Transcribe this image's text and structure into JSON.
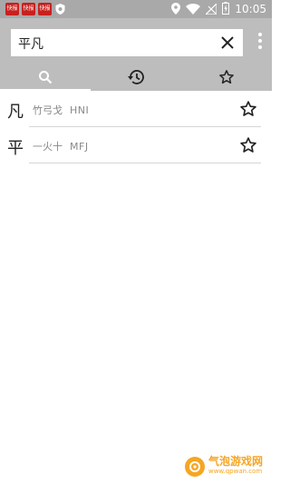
{
  "status_bar": {
    "app_icons": [
      "快报",
      "快报",
      "快报"
    ],
    "time": "10:05"
  },
  "search": {
    "value": "平凡"
  },
  "tabs": [
    {
      "icon": "search-icon",
      "active": true
    },
    {
      "icon": "history-icon",
      "active": false
    },
    {
      "icon": "star-icon",
      "active": false
    }
  ],
  "results": [
    {
      "char": "凡",
      "components": "竹弓戈",
      "code": "HNI"
    },
    {
      "char": "平",
      "components": "一火十",
      "code": "MFJ"
    }
  ],
  "watermark": {
    "title": "气泡游戏网",
    "url": "www.qpwan.com"
  },
  "colors": {
    "status_bar": "#a9a9a9",
    "toolbar": "#bdbdbd",
    "badge_red": "#c8201e",
    "watermark_orange": "#f5a623"
  }
}
